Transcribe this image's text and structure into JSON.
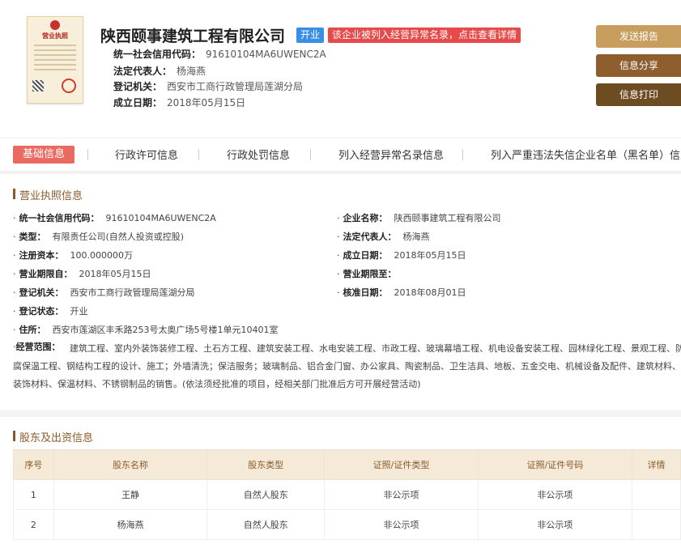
{
  "company": {
    "name": "陕西颐事建筑工程有限公司",
    "status": "开业",
    "abnormal_notice": "该企业被列入经营异常名录，点击查看详情",
    "license_title": "营业执照",
    "fields": [
      {
        "label": "统一社会信用代码：",
        "value": "91610104MA6UWENC2A"
      },
      {
        "label": "法定代表人：",
        "value": "杨海燕"
      },
      {
        "label": "登记机关：",
        "value": "西安市工商行政管理局莲湖分局"
      },
      {
        "label": "成立日期：",
        "value": "2018年05月15日"
      }
    ]
  },
  "actions": [
    "发送报告",
    "信息分享",
    "信息打印"
  ],
  "tabs": [
    "基础信息",
    "行政许可信息",
    "行政处罚信息",
    "列入经营异常名录信息",
    "列入严重违法失信企业名单（黑名单）信息"
  ],
  "license_section": {
    "title": "营业执照信息",
    "left": [
      {
        "label": "统一社会信用代码：",
        "value": "91610104MA6UWENC2A"
      },
      {
        "label": "类型：",
        "value": "有限责任公司(自然人投资或控股)"
      },
      {
        "label": "注册资本：",
        "value": "100.000000万"
      },
      {
        "label": "营业期限自：",
        "value": "2018年05月15日"
      },
      {
        "label": "登记机关：",
        "value": "西安市工商行政管理局莲湖分局"
      },
      {
        "label": "登记状态：",
        "value": "开业"
      },
      {
        "label": "住所：",
        "value": "西安市莲湖区丰禾路253号太奥广场5号楼1单元10401室"
      }
    ],
    "right": [
      {
        "label": "企业名称：",
        "value": "陕西颐事建筑工程有限公司"
      },
      {
        "label": "法定代表人：",
        "value": "杨海燕"
      },
      {
        "label": "成立日期：",
        "value": "2018年05月15日"
      },
      {
        "label": "营业期限至：",
        "value": ""
      },
      {
        "label": "核准日期：",
        "value": "2018年08月01日"
      }
    ],
    "scope_label": "经营范围：",
    "scope_text": "建筑工程、室内外装饰装修工程、土石方工程、建筑安装工程、水电安装工程、市政工程、玻璃幕墙工程、机电设备安装工程、园林绿化工程、景观工程、防腐保温工程、钢结构工程的设计、施工；外墙清洗；保洁服务；玻璃制品、铝合金门窗、办公家具、陶瓷制品、卫生洁具、地板、五金交电、机械设备及配件、建筑材料、装饰材料、保温材料、不锈钢制品的销售。(依法须经批准的项目，经相关部门批准后方可开展经营活动)"
  },
  "shareholders": {
    "title": "股东及出资信息",
    "columns": [
      "序号",
      "股东名称",
      "股东类型",
      "证照/证件类型",
      "证照/证件号码",
      "详情"
    ],
    "rows": [
      [
        "1",
        "王静",
        "自然人股东",
        "非公示项",
        "非公示项",
        ""
      ],
      [
        "2",
        "杨海燕",
        "自然人股东",
        "非公示项",
        "非公示项",
        ""
      ]
    ]
  }
}
